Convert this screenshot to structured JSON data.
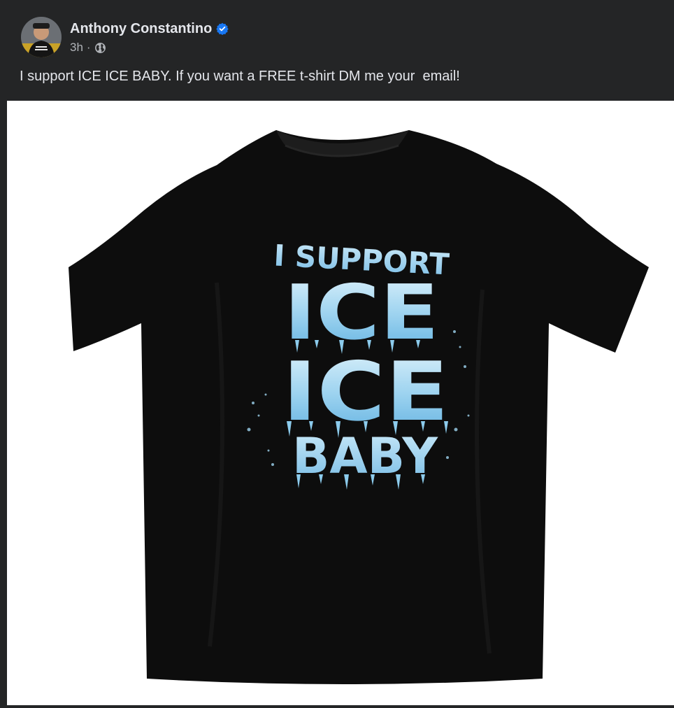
{
  "post": {
    "author": {
      "name": "Anthony Constantino",
      "verified": true
    },
    "timestamp": "3h",
    "separator": "·",
    "audience_icon": "globe-icon",
    "text": "I support ICE ICE BABY. If you want a FREE t-shirt DM me your  email!",
    "image": {
      "shirt_color": "#0d0d0d",
      "shirt_print": {
        "line1": "I SUPPORT",
        "line2": "ICE",
        "line3": "ICE",
        "line4": "BABY"
      }
    }
  },
  "colors": {
    "card_bg": "#242526",
    "text_primary": "#e4e6eb",
    "text_secondary": "#b0b3b8",
    "verified_blue": "#1877f2",
    "ice_light": "#bfe3f6",
    "ice_mid": "#7cc3ea"
  }
}
